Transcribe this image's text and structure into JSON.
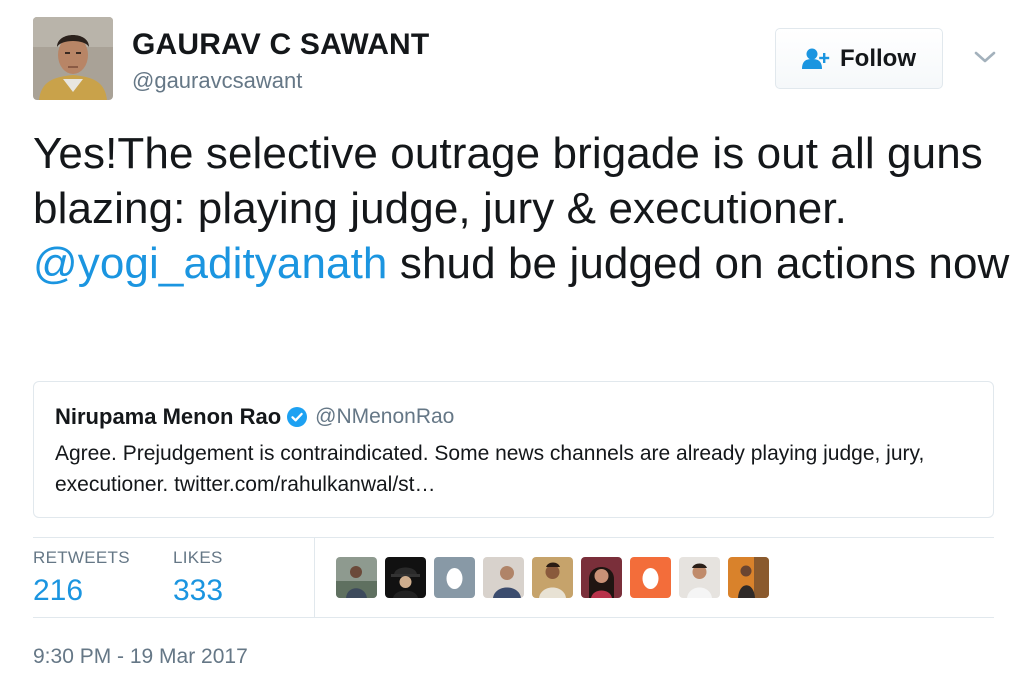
{
  "author": {
    "display_name": "GAURAV C SAWANT",
    "handle": "@gauravcsawant"
  },
  "follow_button": {
    "label": "Follow",
    "icon": "follow-user-icon"
  },
  "more_menu": {
    "icon": "chevron-down-icon"
  },
  "tweet": {
    "text_before": "Yes!The selective outrage brigade is out all guns blazing: playing judge, jury & executioner. ",
    "mention": "@yogi_adityanath",
    "text_after": " shud be judged on actions now"
  },
  "quoted_tweet": {
    "name": "Nirupama Menon Rao",
    "verified_icon": "verified-badge-icon",
    "handle": "@NMenonRao",
    "text": "Agree. Prejudgement is contraindicated. Some news channels are already playing judge, jury, executioner. twitter.com/rahulkanwal/st…"
  },
  "stats": {
    "retweets_label": "RETWEETS",
    "retweets_value": "216",
    "likes_label": "LIKES",
    "likes_value": "333"
  },
  "likers": [
    {
      "icon": "liker-avatar"
    },
    {
      "icon": "liker-avatar"
    },
    {
      "icon": "default-egg-avatar"
    },
    {
      "icon": "liker-avatar"
    },
    {
      "icon": "liker-avatar"
    },
    {
      "icon": "liker-avatar"
    },
    {
      "icon": "default-egg-avatar"
    },
    {
      "icon": "liker-avatar"
    },
    {
      "icon": "liker-avatar"
    }
  ],
  "timestamp": "9:30 PM - 19 Mar 2017",
  "colors": {
    "link": "#1b95e0",
    "muted": "#657786",
    "border": "#e1e8ed",
    "egg_gray": "#8899a6",
    "egg_orange": "#f36d3a"
  }
}
